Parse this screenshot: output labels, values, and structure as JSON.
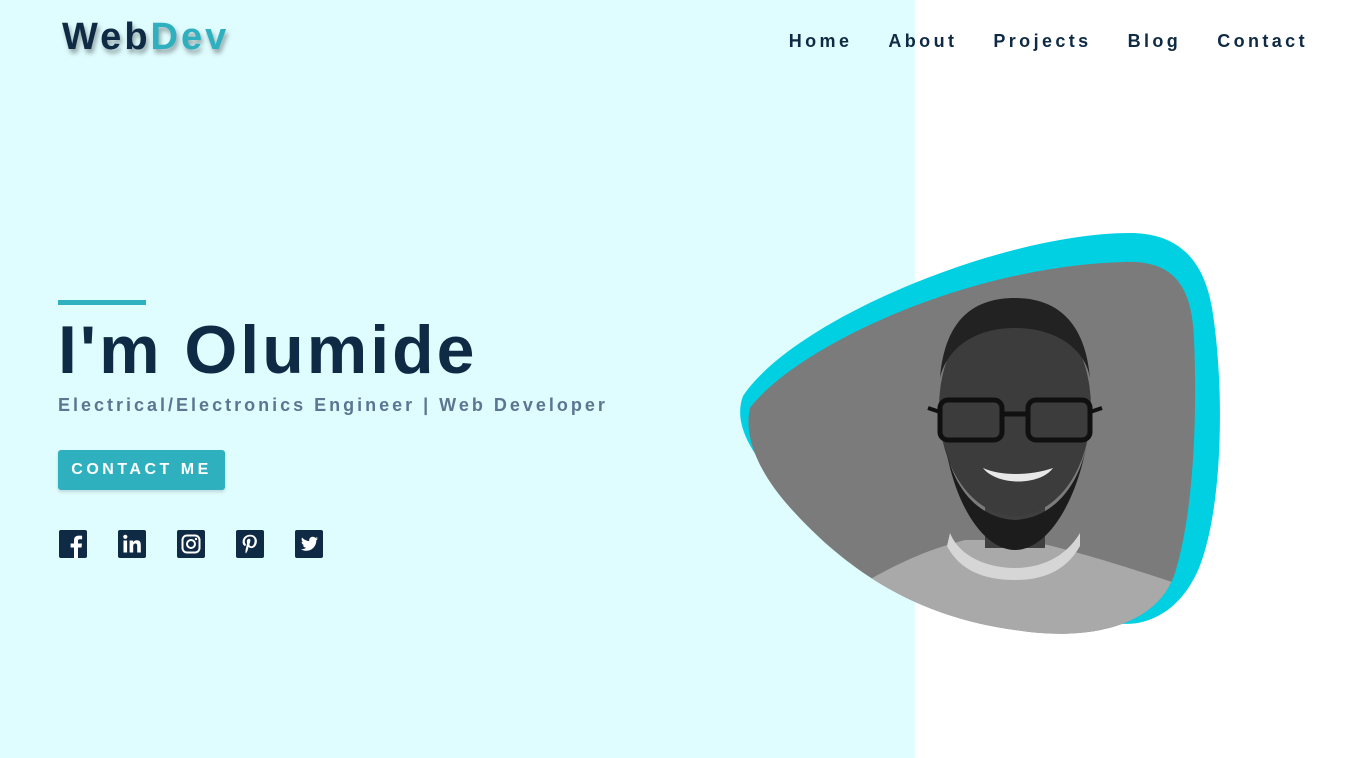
{
  "brand": {
    "logo_part1": "Web",
    "logo_part2": "Dev",
    "colors": {
      "dark": "#0f2a44",
      "accent": "#2fb0bf",
      "blob": "#00d0e2",
      "left_background": "#dffcfe",
      "subtitle": "#5b7691"
    }
  },
  "nav": {
    "items": [
      {
        "label": "Home"
      },
      {
        "label": "About"
      },
      {
        "label": "Projects"
      },
      {
        "label": "Blog"
      },
      {
        "label": "Contact"
      }
    ]
  },
  "hero": {
    "title": "I'm Olumide",
    "subtitle": "Electrical/Electronics Engineer | Web Developer",
    "cta_label": "CONTACT ME"
  },
  "social": {
    "icons": [
      "facebook-icon",
      "linkedin-icon",
      "instagram-icon",
      "pinterest-icon",
      "twitter-icon"
    ]
  },
  "photo": {
    "style": "grayscale portrait inside blob shape"
  }
}
